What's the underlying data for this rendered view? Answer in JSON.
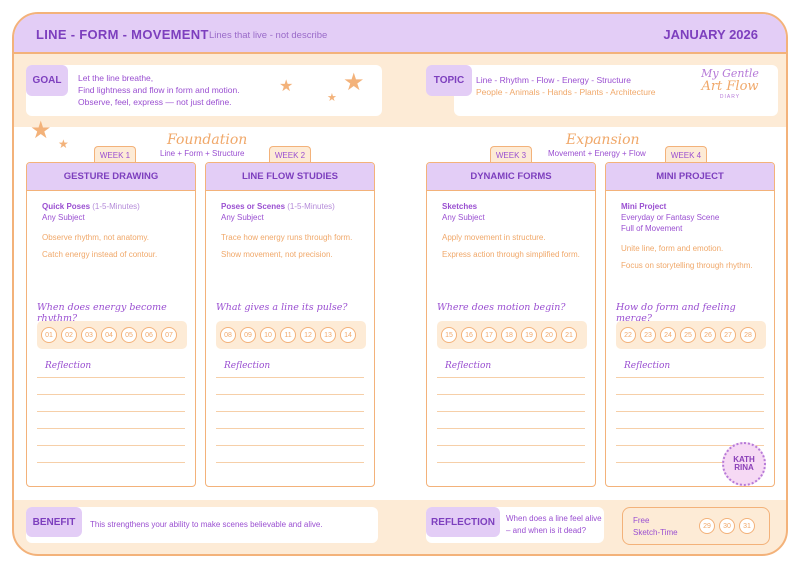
{
  "header": {
    "title": "LINE  - FORM - MOVEMENT",
    "subtitle": "Lines that live - not describe",
    "date": "JANUARY 2026"
  },
  "goal": {
    "label": "GOAL",
    "lines": [
      "Let the line breathe,",
      "Find lightness and flow in form and motion.",
      "Observe, feel, express — not just define."
    ]
  },
  "topic": {
    "label": "TOPIC",
    "line1": "Line - Rhythm - Flow - Energy - Structure",
    "line2": "People - Animals - Hands - Plants - Architecture"
  },
  "logo": {
    "line1": "My Gentle",
    "line2": "Art Flow",
    "line3": "DIARY"
  },
  "sections": [
    {
      "title": "Foundation",
      "subtitle": "Line + Form + Structure"
    },
    {
      "title": "Expansion",
      "subtitle": "Movement + Energy + Flow"
    }
  ],
  "weeks": [
    {
      "tab": "WEEK 1",
      "title": "GESTURE DRAWING",
      "bold": "Quick Poses",
      "range": " (1-5-Minutes)",
      "sub": [
        "Any Subject"
      ],
      "tips": [
        "Observe rhythm, not anatomy.",
        "Catch energy instead of contour."
      ],
      "question": "When does energy become rhythm?",
      "days": [
        "01",
        "02",
        "03",
        "04",
        "05",
        "06",
        "07"
      ],
      "reflection": "Reflection"
    },
    {
      "tab": "WEEK 2",
      "title": "LINE FLOW STUDIES",
      "bold": "Poses or Scenes",
      "range": " (1-5-Minutes)",
      "sub": [
        "Any Subject"
      ],
      "tips": [
        "Trace how energy runs through form.",
        "Show movement, not precision."
      ],
      "question": "What gives a line its pulse?",
      "days": [
        "08",
        "09",
        "10",
        "11",
        "12",
        "13",
        "14"
      ],
      "reflection": "Reflection"
    },
    {
      "tab": "WEEK 3",
      "title": "DYNAMIC FORMS",
      "bold": "Sketches",
      "range": "",
      "sub": [
        "Any Subject"
      ],
      "tips": [
        "Apply movement in structure.",
        "Express action through simplified form."
      ],
      "question": "Where does motion begin?",
      "days": [
        "15",
        "16",
        "17",
        "18",
        "19",
        "20",
        "21"
      ],
      "reflection": "Reflection"
    },
    {
      "tab": "WEEK 4",
      "title": "MINI PROJECT",
      "bold": "Mini Project",
      "range": "",
      "sub": [
        "Everyday or Fantasy Scene",
        "Full of Movement"
      ],
      "tips": [
        "Unite line, form  and emotion.",
        "Focus on storytelling through rhythm."
      ],
      "question": "How do form and feeling merge?",
      "days": [
        "22",
        "23",
        "24",
        "25",
        "26",
        "27",
        "28"
      ],
      "reflection": "Reflection"
    }
  ],
  "benefit": {
    "label": "BENEFIT",
    "text": "This strengthens your ability to make scenes believable and alive."
  },
  "reflection_footer": {
    "label": "REFLECTION",
    "line1": "When does a line feel alive",
    "line2": "– and when is it dead?"
  },
  "free": {
    "line1": "Free",
    "line2": "Sketch-Time",
    "days": [
      "29",
      "30",
      "31"
    ]
  },
  "stamp": {
    "text": "KATH RINA"
  },
  "colors": {
    "purple": "#7d3fbe",
    "lavender": "#e3cdf6",
    "peach": "#fdebd6",
    "orange": "#f3b27a"
  }
}
